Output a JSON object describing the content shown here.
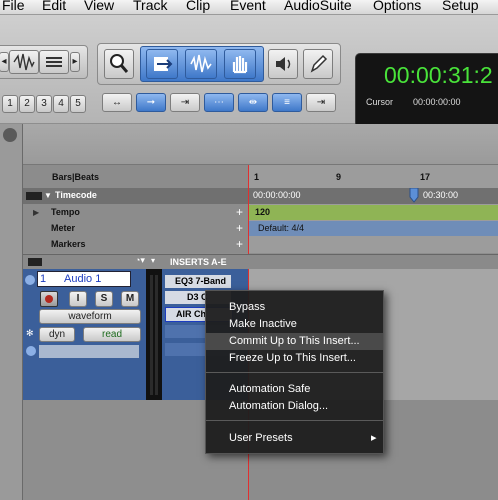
{
  "menubar": {
    "items": [
      {
        "label": "File"
      },
      {
        "label": "Edit"
      },
      {
        "label": "View"
      },
      {
        "label": "Track"
      },
      {
        "label": "Clip"
      },
      {
        "label": "Event"
      },
      {
        "label": "AudioSuite"
      },
      {
        "label": "Options"
      },
      {
        "label": "Setup"
      }
    ]
  },
  "toolbar": {
    "zoom_presets": [
      "1",
      "2",
      "3",
      "4",
      "5"
    ],
    "counter_main": "00:00:31:2",
    "cursor_label": "Cursor",
    "cursor_value": "00:00:00:00"
  },
  "rulers": {
    "bars_beats": {
      "label": "Bars|Beats",
      "marks": [
        "1",
        "9",
        "17"
      ]
    },
    "timecode": {
      "label": "Timecode",
      "start": "00:00:00:00",
      "mark": "00:30:00"
    },
    "tempo": {
      "label": "Tempo",
      "value": "120"
    },
    "meter": {
      "label": "Meter",
      "value": "Default: 4/4"
    },
    "markers": {
      "label": "Markers"
    },
    "plus": "+"
  },
  "track": {
    "number": "1",
    "name": "Audio 1",
    "buttons": {
      "record": "",
      "input": "I",
      "solo": "S",
      "mute": "M"
    },
    "view": "waveform",
    "dyn": "dyn",
    "automation": "read",
    "inserts_header": "INSERTS A-E",
    "inserts": [
      "EQ3 7-Band",
      "D3 C",
      "AIR Ch"
    ]
  },
  "context_menu": {
    "items": [
      {
        "label": "Bypass"
      },
      {
        "label": "Make Inactive"
      },
      {
        "label": "Commit Up to This Insert..."
      },
      {
        "label": "Freeze Up to This Insert..."
      },
      {
        "label": "Automation Safe"
      },
      {
        "label": "Automation Dialog..."
      },
      {
        "label": "User Presets",
        "submenu_arrow": "▸"
      }
    ]
  },
  "colors": {
    "accent_blue": "#3f78c9",
    "counter_green": "#49e33a",
    "tempo_bar": "#8fb455",
    "meter_bar": "#6f8db8",
    "timeline_marker": "#e03030"
  }
}
